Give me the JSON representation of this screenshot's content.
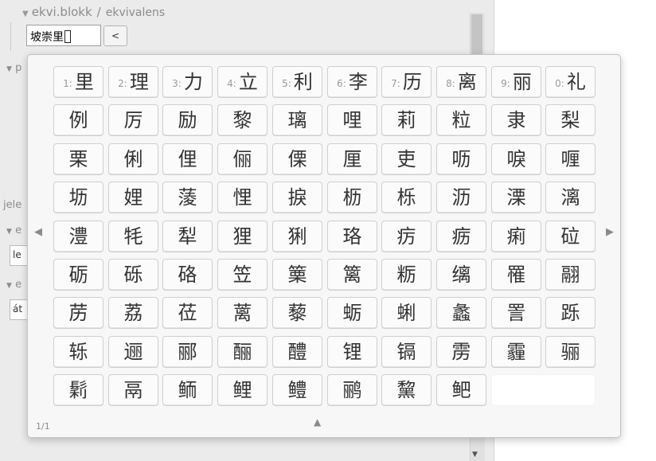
{
  "background": {
    "breadcrumb": {
      "current": "ekvi.blokk",
      "separator": "/",
      "sub": "ekvivalens"
    },
    "input": {
      "value": "坡崇里"
    },
    "back_button": {
      "label": "<"
    },
    "left_labels": [
      "p",
      "jele",
      "e",
      "e"
    ],
    "fields": [
      "le",
      "át"
    ]
  },
  "candidate_popup": {
    "page_indicator": "1/1",
    "numbered_row": [
      {
        "num": "1:",
        "char": "里"
      },
      {
        "num": "2:",
        "char": "理"
      },
      {
        "num": "3:",
        "char": "力"
      },
      {
        "num": "4:",
        "char": "立"
      },
      {
        "num": "5:",
        "char": "利"
      },
      {
        "num": "6:",
        "char": "李"
      },
      {
        "num": "7:",
        "char": "历"
      },
      {
        "num": "8:",
        "char": "离"
      },
      {
        "num": "9:",
        "char": "丽"
      },
      {
        "num": "0:",
        "char": "礼"
      }
    ],
    "rows": [
      [
        "例",
        "厉",
        "励",
        "黎",
        "璃",
        "哩",
        "莉",
        "粒",
        "隶",
        "梨"
      ],
      [
        "栗",
        "俐",
        "俚",
        "俪",
        "傈",
        "厘",
        "吏",
        "呖",
        "唳",
        "喱"
      ],
      [
        "坜",
        "娌",
        "蔆",
        "悝",
        "捩",
        "枥",
        "栎",
        "沥",
        "溧",
        "漓"
      ],
      [
        "澧",
        "牦",
        "犁",
        "狸",
        "猁",
        "珞",
        "疠",
        "疬",
        "痢",
        "砬"
      ],
      [
        "砺",
        "砾",
        "硌",
        "笠",
        "篥",
        "篱",
        "粝",
        "缡",
        "罹",
        "翮"
      ],
      [
        "苈",
        "荔",
        "莅",
        "蓠",
        "藜",
        "蛎",
        "蜊",
        "蠡",
        "詈",
        "跞"
      ],
      [
        "轹",
        "逦",
        "郦",
        "酾",
        "醴",
        "锂",
        "镉",
        "雳",
        "霾",
        "骊"
      ],
      [
        "鬁",
        "鬲",
        "鲕",
        "鲤",
        "鳢",
        "鹂",
        "黧",
        "鲃",
        ""
      ]
    ]
  },
  "icons": {
    "left": "◀",
    "right": "▶",
    "up": "▲",
    "scroll_down": "▼",
    "collapse": "▼"
  }
}
